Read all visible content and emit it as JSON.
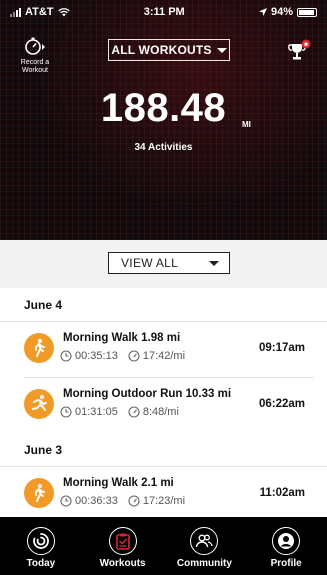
{
  "status_bar": {
    "carrier": "AT&T",
    "time": "3:11 PM",
    "battery": "94%"
  },
  "header": {
    "record_label_line1": "Record a",
    "record_label_line2": "Workout",
    "filter_label": "ALL WORKOUTS",
    "total_distance": "188.48",
    "distance_unit": "MI",
    "activity_count": "34 Activities"
  },
  "view_filter": {
    "label": "VIEW ALL"
  },
  "feed": [
    {
      "date": "June 4",
      "items": [
        {
          "title": "Morning Walk 1.98 mi",
          "duration": "00:35:13",
          "pace": "17:42/mi",
          "time": "09:17am",
          "type": "walk"
        },
        {
          "title": "Morning Outdoor Run 10.33 mi",
          "duration": "01:31:05",
          "pace": "8:48/mi",
          "time": "06:22am",
          "type": "run"
        }
      ]
    },
    {
      "date": "June 3",
      "items": [
        {
          "title": "Morning Walk 2.1 mi",
          "duration": "00:36:33",
          "pace": "17:23/mi",
          "time": "11:02am",
          "type": "walk"
        }
      ]
    }
  ],
  "tabs": [
    {
      "label": "Today",
      "icon": "today-ring-icon"
    },
    {
      "label": "Workouts",
      "icon": "workouts-clipboard-icon"
    },
    {
      "label": "Community",
      "icon": "community-icon"
    },
    {
      "label": "Profile",
      "icon": "profile-icon"
    }
  ],
  "colors": {
    "accent": "#f19a27",
    "workouts_active": "#d9262f",
    "hero_bg": "#0d0b0c"
  }
}
